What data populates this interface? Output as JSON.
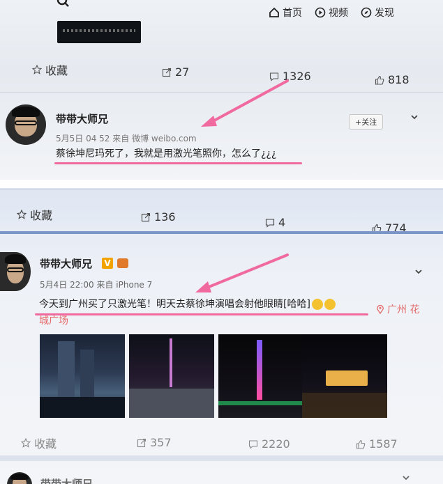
{
  "nav": {
    "home": "首页",
    "video": "视频",
    "discover": "发现"
  },
  "post1": {
    "actions": {
      "favorite": "收藏",
      "repost": "27",
      "comment": "1326",
      "like": "818"
    },
    "user": "带带大师兄",
    "meta": "5月5日 04 52 来自 微博 weibo.com",
    "follow": "+关注",
    "text": "蔡徐坤尼玛死了，我就是用激光笔照你，怎么了¿¿¿"
  },
  "post2": {
    "actions": {
      "favorite": "收藏",
      "repost": "136",
      "comment": "4",
      "like": "774"
    },
    "user": "带带大师兄",
    "vip": "V",
    "meta": "5月4日 22:00 来自 iPhone 7",
    "text": "今天到广州买了只激光笔！明天去蔡徐坤演唱会射他眼睛[哈哈]",
    "location": "广州 花",
    "location2": "城广场",
    "bottom": {
      "favorite": "收藏",
      "repost": "357",
      "comment": "2220",
      "like": "1587"
    }
  },
  "post3": {
    "user": "带带大师兄"
  },
  "colors": {
    "highlight": "#f06aa0",
    "location": "#e56a6a"
  },
  "icons": [
    "search-icon",
    "home-icon",
    "video-icon",
    "discover-icon",
    "star-icon",
    "repost-icon",
    "comment-icon",
    "like-icon",
    "chevron-down-icon",
    "location-icon"
  ]
}
